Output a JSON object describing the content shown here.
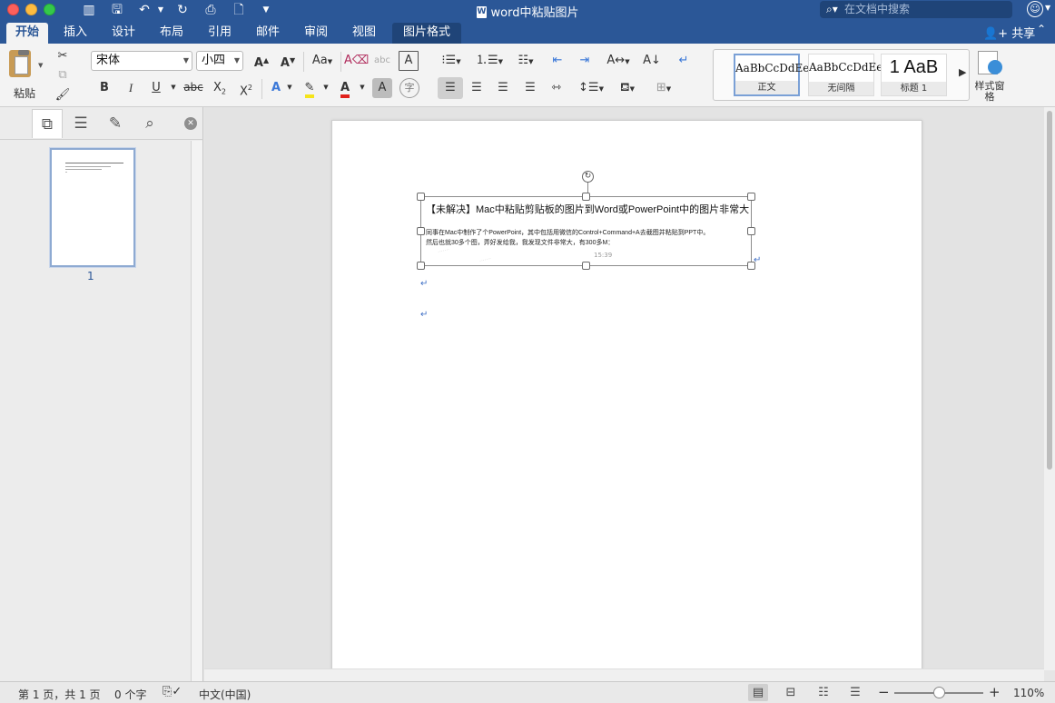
{
  "window": {
    "title": "word中粘贴图片",
    "search_placeholder": "在文档中搜索"
  },
  "tabs": [
    {
      "label": "开始"
    },
    {
      "label": "插入"
    },
    {
      "label": "设计"
    },
    {
      "label": "布局"
    },
    {
      "label": "引用"
    },
    {
      "label": "邮件"
    },
    {
      "label": "审阅"
    },
    {
      "label": "视图"
    },
    {
      "label": "图片格式"
    }
  ],
  "share_label": "共享",
  "ribbon": {
    "paste_label": "粘贴",
    "font_name": "宋体",
    "font_size": "小四",
    "styles": [
      {
        "sample": "AaBbCcDdEe",
        "name": "正文"
      },
      {
        "sample": "AaBbCcDdEe",
        "name": "无间隔"
      },
      {
        "sample": "1 AaB",
        "name": "标题 1"
      }
    ],
    "styles_pane_label": "样式窗格"
  },
  "nav": {
    "page_number": "1"
  },
  "document": {
    "picture_title": "【未解决】Mac中粘贴剪贴板的图片到Word或PowerPoint中的图片非常大",
    "picture_body_line1": "同事在Mac中制作了个PowerPoint，其中包括用微信的Control+Command+A去截图并粘贴到PPT中。",
    "picture_body_line2": "然后也就30多个图，弄好发给我，我发现文件非常大，有300多M：",
    "picture_time": "15:39"
  },
  "status": {
    "page": "第 1 页，共 1 页",
    "words": "0 个字",
    "language": "中文(中国)",
    "zoom": "110%"
  }
}
